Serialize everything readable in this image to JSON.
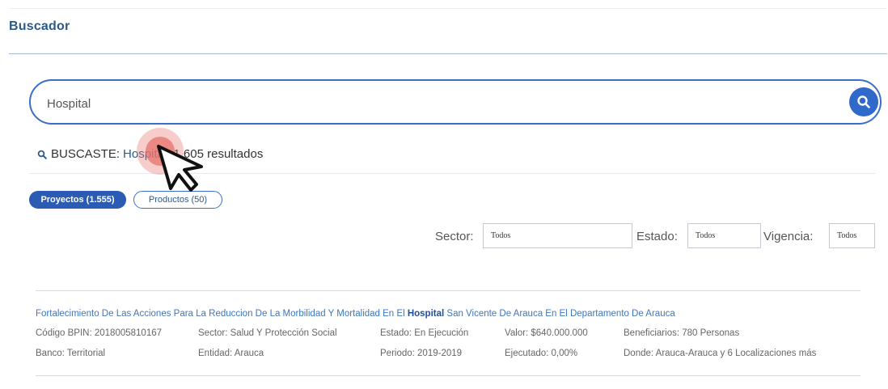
{
  "header": {
    "title": "Buscador"
  },
  "search": {
    "value": "Hospital",
    "placeholder": ""
  },
  "result_summary": {
    "prefix": "BUSCASTE:",
    "term": "Hospital",
    "separator": ",",
    "count_text": "1.605 resultados"
  },
  "tabs": [
    {
      "label": "Proyectos (1.555)",
      "active": true
    },
    {
      "label": "Productos (50)",
      "active": false
    }
  ],
  "filters": {
    "sector": {
      "label": "Sector:",
      "value": "Todos"
    },
    "estado": {
      "label": "Estado:",
      "value": "Todos"
    },
    "vigencia": {
      "label": "Vigencia:",
      "value": "Todos"
    }
  },
  "project": {
    "title_before": "Fortalecimiento De Las Acciones Para La Reduccion De La Morbilidad Y Mortalidad En El ",
    "title_highlight": "Hospital",
    "title_after": " San Vicente De Arauca En El Departamento De Arauca",
    "codigo": "Código BPIN: 2018005810167",
    "sector": "Sector: Salud Y Protección Social",
    "estado": "Estado: En Ejecución",
    "valor": "Valor: $640.000.000",
    "beneficiarios": "Beneficiarios: 780 Personas",
    "banco": "Banco: Territorial",
    "entidad": "Entidad: Arauca",
    "periodo": "Periodo: 2019-2019",
    "ejecutado": "Ejecutado: 0,00%",
    "donde": "Donde: Arauca-Arauca y 6 Localizaciones más"
  },
  "colors": {
    "accent": "#2f69c9",
    "brand_text": "#2c5a8a",
    "link": "#3d77bf",
    "click_marker": "#e8706a"
  }
}
